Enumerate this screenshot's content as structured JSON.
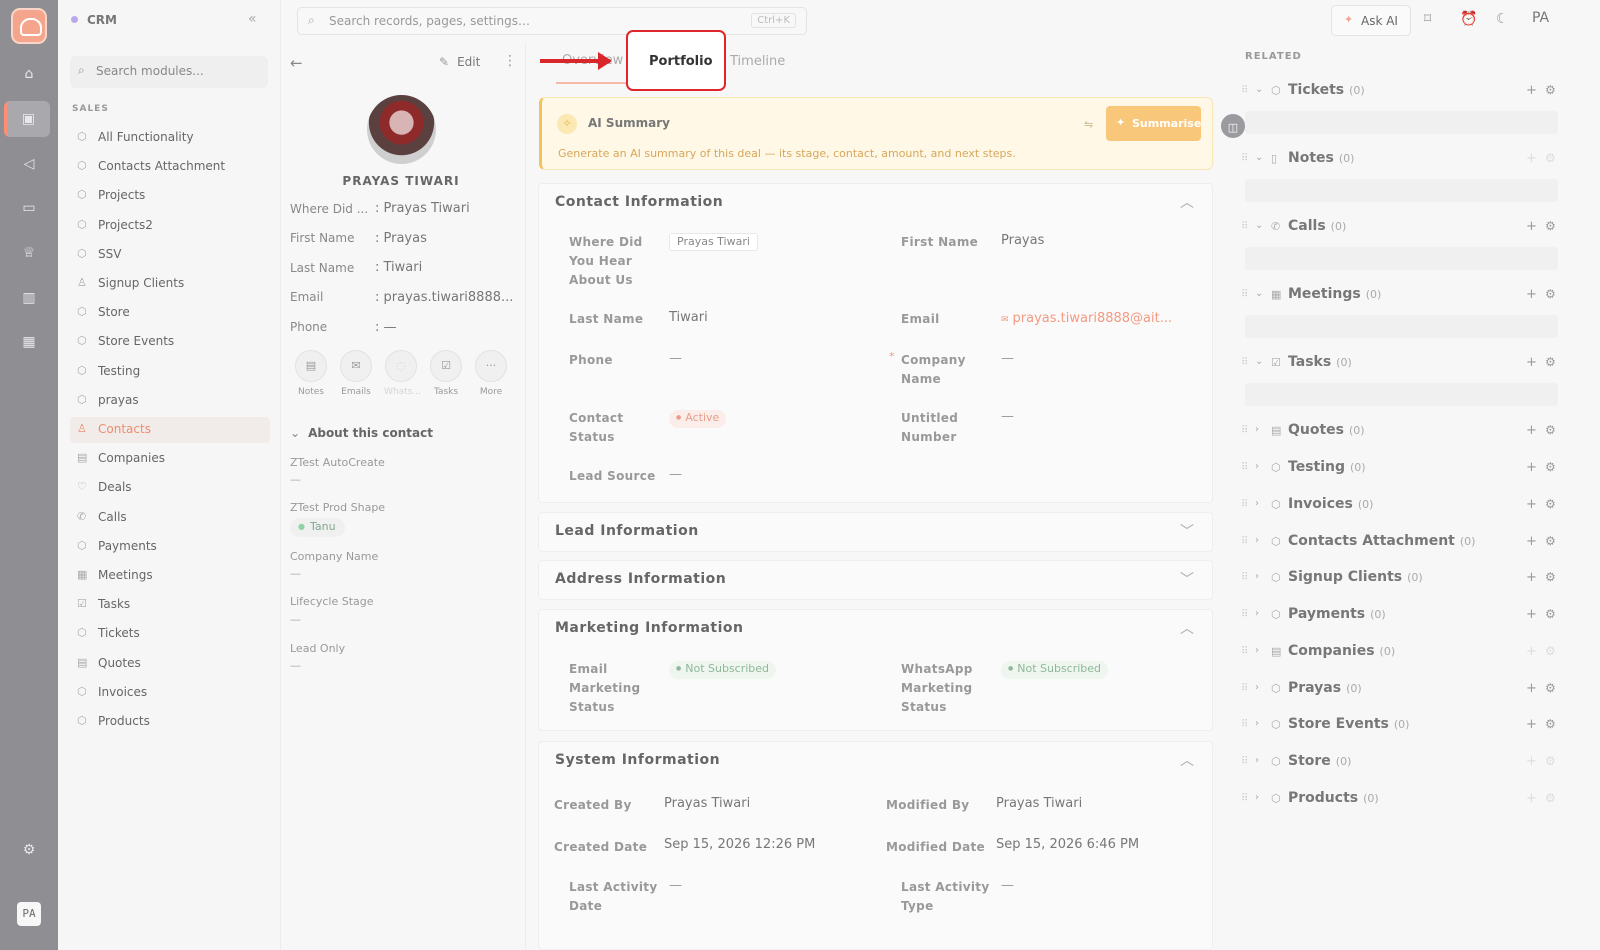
{
  "app": {
    "name": "CRM"
  },
  "global_search": {
    "placeholder": "Search records, pages, settings…",
    "shortcut": "Ctrl+K"
  },
  "topbar": {
    "ask_ai": "Ask AI",
    "user_initials": "PA"
  },
  "rail": {
    "user_initials": "PA",
    "icons": [
      "home-icon",
      "briefcase-icon",
      "megaphone-icon",
      "inbox-icon",
      "trophy-icon",
      "chart-icon",
      "calendar-icon"
    ]
  },
  "sidebar": {
    "search_placeholder": "Search modules...",
    "section": "SALES",
    "items": [
      {
        "label": "All Functionality"
      },
      {
        "label": "Contacts Attachment"
      },
      {
        "label": "Projects"
      },
      {
        "label": "Projects2"
      },
      {
        "label": "SSV"
      },
      {
        "label": "Signup Clients"
      },
      {
        "label": "Store"
      },
      {
        "label": "Store Events"
      },
      {
        "label": "Testing"
      },
      {
        "label": "prayas"
      },
      {
        "label": "Contacts",
        "active": true
      },
      {
        "label": "Companies"
      },
      {
        "label": "Deals"
      },
      {
        "label": "Calls"
      },
      {
        "label": "Payments"
      },
      {
        "label": "Meetings"
      },
      {
        "label": "Tasks"
      },
      {
        "label": "Tickets"
      },
      {
        "label": "Quotes"
      },
      {
        "label": "Invoices"
      },
      {
        "label": "Products"
      }
    ]
  },
  "record": {
    "edit_label": "Edit",
    "name": "PRAYAS TIWARI",
    "fields": [
      {
        "label": "Where Did ...",
        "value": ": Prayas Tiwari"
      },
      {
        "label": "First Name",
        "value": ": Prayas"
      },
      {
        "label": "Last Name",
        "value": ": Tiwari"
      },
      {
        "label": "Email",
        "value": ": prayas.tiwari8888..."
      },
      {
        "label": "Phone",
        "value": ": —"
      }
    ],
    "actions": [
      {
        "label": "Notes"
      },
      {
        "label": "Emails"
      },
      {
        "label": "Whats..."
      },
      {
        "label": "Tasks"
      },
      {
        "label": "More"
      }
    ],
    "about_title": "About this contact",
    "about": {
      "autocreate_label": "ZTest AutoCreate",
      "autocreate_value": "—",
      "shape_label": "ZTest Prod Shape",
      "shape_value": "Tanu",
      "company_label": "Company Name",
      "company_value": "—",
      "lifecycle_label": "Lifecycle Stage",
      "lifecycle_value": "—",
      "leadonly_label": "Lead Only",
      "leadonly_value": "—"
    }
  },
  "tabs": [
    {
      "label": "Overview"
    },
    {
      "label": "Portfolio"
    },
    {
      "label": "Timeline"
    }
  ],
  "ai_summary": {
    "title": "AI Summary",
    "description": "Generate an AI summary of this deal — its stage, contact, amount, and next steps.",
    "button": "Summarise"
  },
  "contact_info": {
    "title": "Contact Information",
    "where_label": "Where Did You Hear About Us",
    "where_value": "Prayas Tiwari",
    "first_label": "First Name",
    "first_value": "Prayas",
    "last_label": "Last Name",
    "last_value": "Tiwari",
    "email_label": "Email",
    "email_value": "prayas.tiwari8888@ait...",
    "phone_label": "Phone",
    "phone_value": "—",
    "company_label": "Company Name",
    "company_value": "—",
    "status_label": "Contact Status",
    "status_value": "Active",
    "untitled_label": "Untitled Number",
    "untitled_value": "—",
    "source_label": "Lead Source",
    "source_value": "—"
  },
  "lead_info": {
    "title": "Lead Information"
  },
  "address_info": {
    "title": "Address Information"
  },
  "marketing_info": {
    "title": "Marketing Information",
    "email_label": "Email Marketing Status",
    "email_value": "Not Subscribed",
    "whatsapp_label": "WhatsApp Marketing Status",
    "whatsapp_value": "Not Subscribed"
  },
  "system_info": {
    "title": "System Information",
    "created_by_label": "Created By",
    "created_by_value": "Prayas Tiwari",
    "modified_by_label": "Modified By",
    "modified_by_value": "Prayas Tiwari",
    "created_date_label": "Created Date",
    "created_date_value": "Sep 15, 2026 12:26 PM",
    "modified_date_label": "Modified Date",
    "modified_date_value": "Sep 15, 2026 6:46 PM",
    "last_activity_date_label": "Last Activity Date",
    "last_activity_date_value": "—",
    "last_activity_type_label": "Last Activity Type",
    "last_activity_type_value": "—"
  },
  "related": {
    "title": "RELATED",
    "items": [
      {
        "name": "Tickets",
        "count": "(0)"
      },
      {
        "name": "Notes",
        "count": "(0)"
      },
      {
        "name": "Calls",
        "count": "(0)"
      },
      {
        "name": "Meetings",
        "count": "(0)"
      },
      {
        "name": "Tasks",
        "count": "(0)"
      },
      {
        "name": "Quotes",
        "count": "(0)"
      },
      {
        "name": "Testing",
        "count": "(0)"
      },
      {
        "name": "Invoices",
        "count": "(0)"
      },
      {
        "name": "Contacts Attachment",
        "count": "(0)"
      },
      {
        "name": "Signup Clients",
        "count": "(0)"
      },
      {
        "name": "Payments",
        "count": "(0)"
      },
      {
        "name": "Companies",
        "count": "(0)"
      },
      {
        "name": "Prayas",
        "count": "(0)"
      },
      {
        "name": "Store Events",
        "count": "(0)"
      },
      {
        "name": "Store",
        "count": "(0)"
      },
      {
        "name": "Products",
        "count": "(0)"
      }
    ]
  },
  "colors": {
    "accent": "#f08b6e",
    "highlight": "#e0262b",
    "rail": "#8e8e93"
  }
}
